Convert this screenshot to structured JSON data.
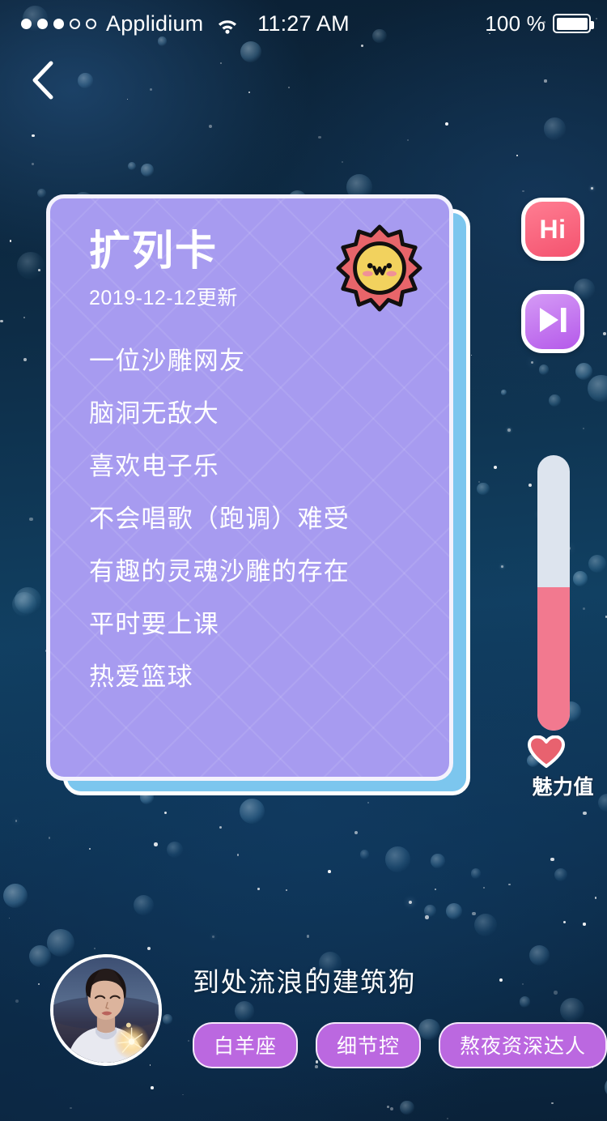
{
  "status_bar": {
    "signal_dots_filled": 3,
    "signal_dots_total": 5,
    "carrier": "Applidium",
    "wifi_icon": "wifi-icon",
    "time": "11:27 AM",
    "battery_percent": "100 %",
    "battery_icon": "battery-full-icon"
  },
  "nav": {
    "back_icon": "chevron-left-icon"
  },
  "card": {
    "title": "扩列卡",
    "date": "2019-12-12更新",
    "badge_icon": "sun-face-icon",
    "lines": [
      "一位沙雕网友",
      "脑洞无敌大",
      "喜欢电子乐",
      "不会唱歌（跑调）难受",
      "有趣的灵魂沙雕的存在",
      "平时要上课",
      "热爱篮球"
    ],
    "color": "#a79bf0",
    "under_card_color": "#7cc6ee"
  },
  "actions": {
    "hi_label": "Hi",
    "hi_icon": "hi-button-icon",
    "hi_color": "#f4536f",
    "next_icon": "skip-next-icon",
    "next_color": "#b559ea"
  },
  "charm_meter": {
    "label": "魅力值",
    "heart_icon": "heart-icon",
    "fill_percent": 52,
    "fill_color": "#f2798f",
    "track_color": "#dde4ee"
  },
  "profile": {
    "avatar_icon": "user-avatar",
    "username": "到处流浪的建筑狗",
    "tags": [
      "白羊座",
      "细节控",
      "熬夜资深达人"
    ],
    "tag_color": "#bb68e0"
  }
}
